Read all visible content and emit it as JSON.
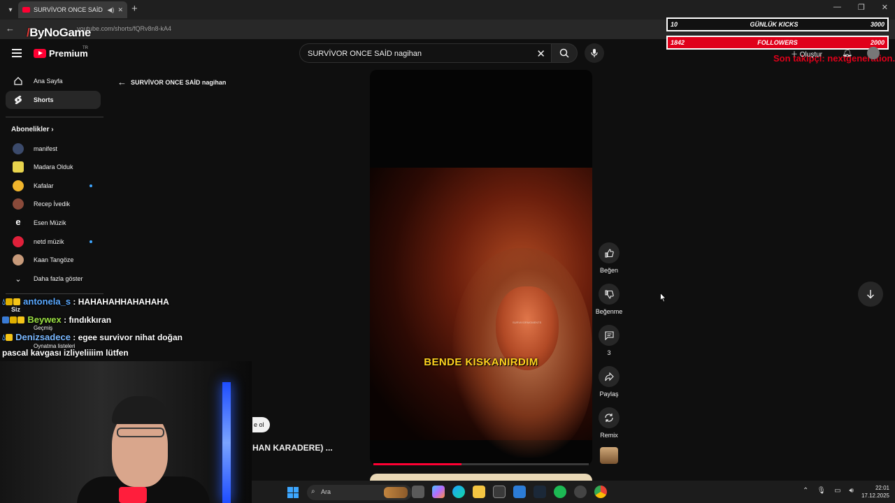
{
  "browser": {
    "tab_title": "SURVİVOR ONCE SAİD nagihan",
    "url": "youtube.com/shorts/fQRv8n8-kA4",
    "overlay_logo": "ByNoGame"
  },
  "kick_overlay": {
    "bar1": {
      "left": "10",
      "label": "GÜNLÜK KICKS",
      "right": "3000"
    },
    "bar2": {
      "left": "1842",
      "label": "FOLLOWERS",
      "right": "2000"
    },
    "last_follower": "Son takipçi: nextgeneration.tv"
  },
  "youtube": {
    "logo_text": "Premium",
    "logo_country": "TR",
    "search": {
      "value": "SURVİVOR ONCE SAİD nagihan"
    },
    "header": {
      "create_label": "Oluştur"
    },
    "sidebar": {
      "items": [
        {
          "label": "Ana Sayfa"
        },
        {
          "label": "Shorts"
        }
      ],
      "subscriptions_heading": "Abonelikler",
      "channels": [
        {
          "name": "manifest",
          "new": false,
          "color": "#3b4a6b"
        },
        {
          "name": "Madara Olduk",
          "new": false,
          "color": "#e8d44d"
        },
        {
          "name": "Kafalar",
          "new": true,
          "color": "#f0b52c"
        },
        {
          "name": "Recep İvedik",
          "new": false,
          "color": "#8a4a3a"
        },
        {
          "name": "Esen Müzik",
          "new": false,
          "color": "#ffffff"
        },
        {
          "name": "netd müzik",
          "new": true,
          "color": "#e0203a"
        },
        {
          "name": "Kaan Tangöze",
          "new": false,
          "color": "#c79a7a"
        }
      ],
      "show_more": "Daha fazla göster",
      "you_label": "Siz",
      "history_label": "Geçmiş",
      "playlists_label": "Oynatma listeleri"
    },
    "back_row_title": "SURVİVOR ONCE SAİD nagihan",
    "video": {
      "watermark": "SURVIVORMOMENTS",
      "caption": "BENDE KISKANIRDIM",
      "progress": 0.41
    },
    "actions": {
      "like": "Beğen",
      "dislike": "Beğenme",
      "comments": "3",
      "share": "Paylaş",
      "remix": "Remix"
    },
    "partial_subscribe": "e ol",
    "partial_title": "HAN KARADERE) ..."
  },
  "chat": [
    {
      "user": "antonela_s",
      "user_color": "#5aa9ff",
      "message": ": HAHAHAHHAHAHAHA"
    },
    {
      "user": "Beywex",
      "user_color": "#9be043",
      "message": ": fındıkkıran"
    },
    {
      "user": "Denizsadece",
      "user_color": "#7ab8ff",
      "message": ": egee survivor nihat doğan"
    }
  ],
  "chat_wrap": "pascal kavgası izliyeliiiim lütfen",
  "taskbar": {
    "search_placeholder": "Ara",
    "time": "22:01",
    "date": "17.12.2025"
  }
}
